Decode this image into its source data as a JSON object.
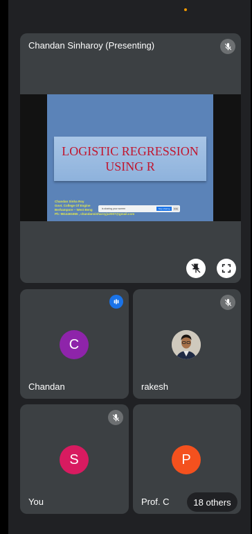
{
  "main_tile": {
    "title": "Chandan Sinharoy (Presenting)",
    "slide": {
      "title_line1": "LOGISTIC REGRESSION",
      "title_line2": "USING R",
      "info_line1": "Chandan Sinha Roy",
      "info_line2": "Govt. College Of Engine",
      "info_line3": "Berhampore – West Beng",
      "info_line4": "Ph: 9614461655 , chandansinharoyju2007@gmail.com",
      "toast_text": "is sharing your screen",
      "toast_stop": "Stop sharing",
      "toast_hide": "Hide"
    }
  },
  "participants": [
    {
      "name": "Chandan",
      "initial": "C",
      "color": "#8e24aa",
      "speaking": true
    },
    {
      "name": "rakesh",
      "initial": "",
      "muted": true
    },
    {
      "name": "You",
      "initial": "S",
      "color": "#d81b60",
      "muted": true
    },
    {
      "name": "Prof. C",
      "initial": "P",
      "color": "#f4511e"
    }
  ],
  "others_label": "18 others",
  "colors": {
    "tile_bg": "#3c4043",
    "page_bg": "#202124",
    "accent_blue": "#1a73e8"
  }
}
